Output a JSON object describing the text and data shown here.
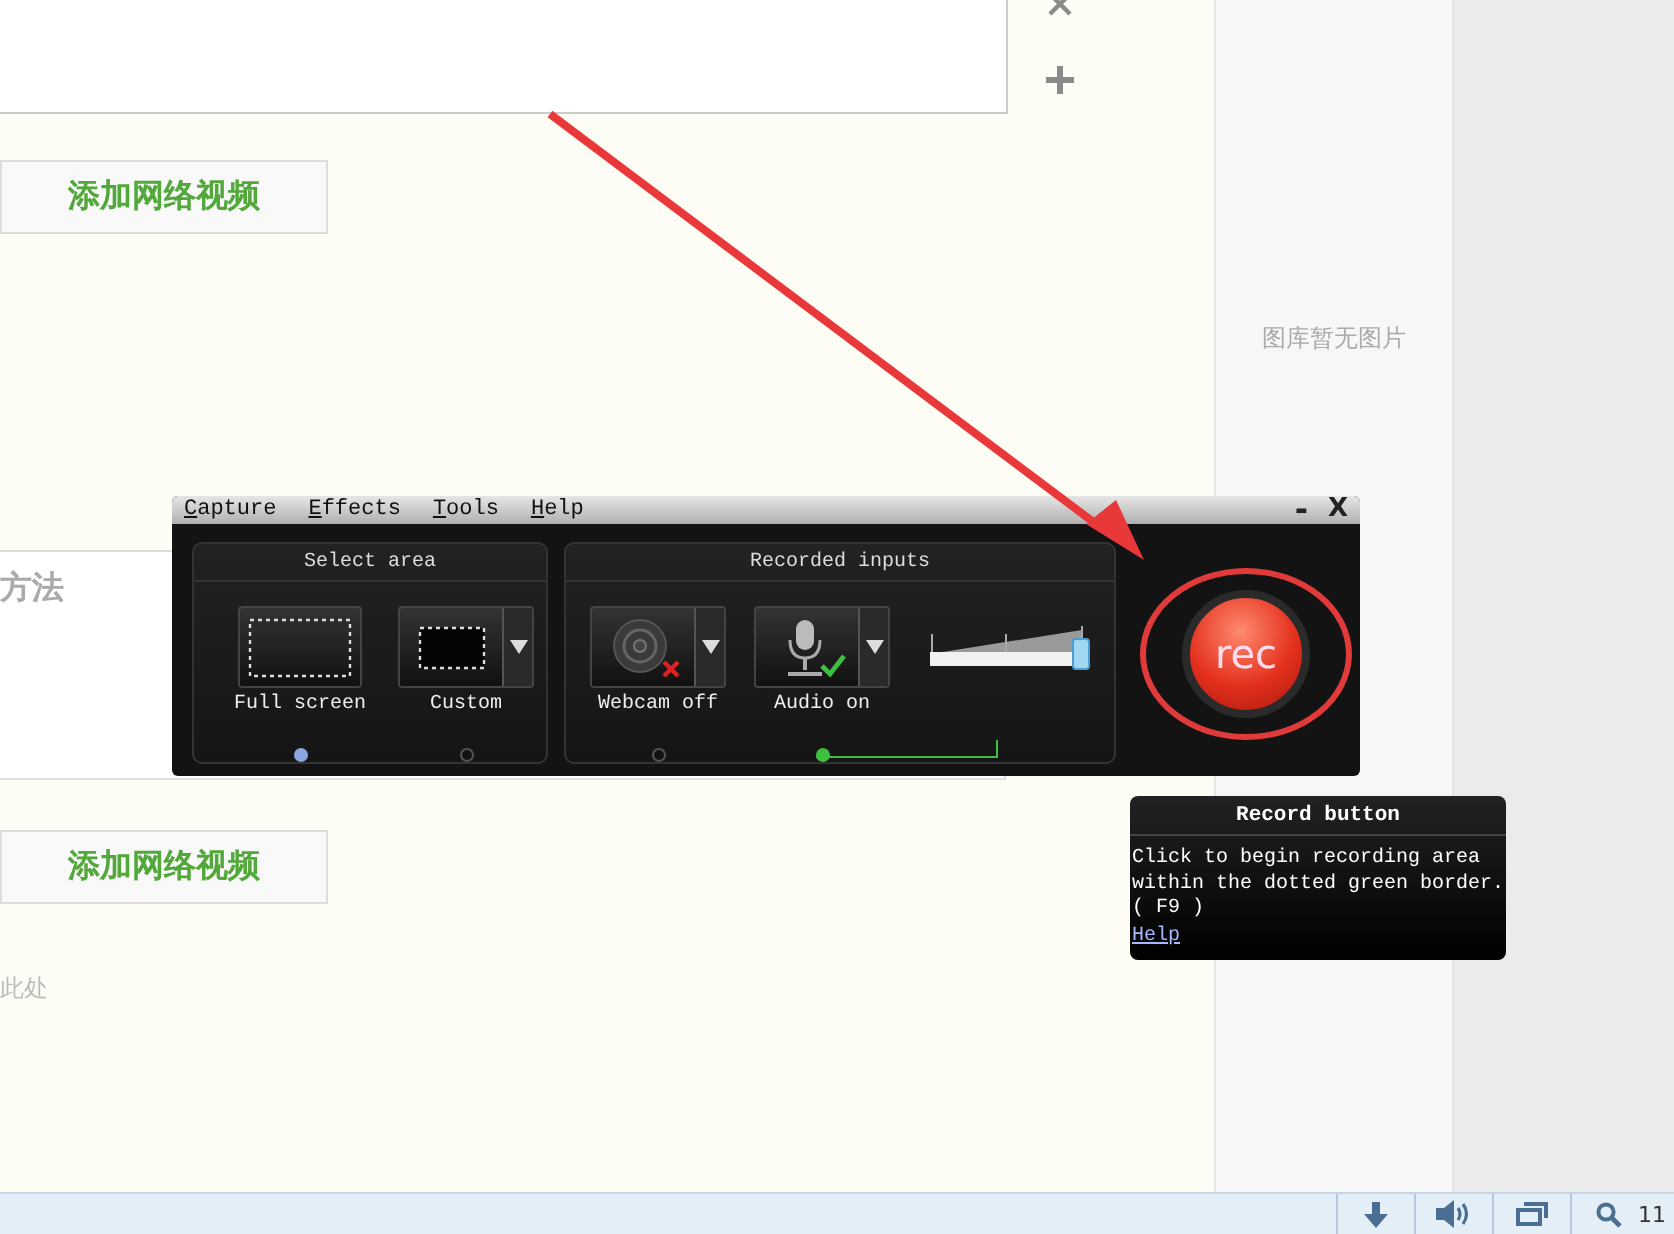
{
  "page": {
    "buttons": [
      {
        "label": "添加网络视频"
      },
      {
        "label": "添加网络视频"
      }
    ],
    "heading": "方法",
    "hint": "此处",
    "sidebar": {
      "empty_text": "图库暂无图片"
    }
  },
  "recorder": {
    "menu": [
      "Capture",
      "Effects",
      "Tools",
      "Help"
    ],
    "window_controls": [
      {
        "kind": "minimize",
        "label": "-"
      },
      {
        "kind": "close",
        "label": "X"
      }
    ],
    "sections": [
      {
        "title": "Select area",
        "options": [
          {
            "kind": "full",
            "label": "Full screen",
            "dropdown": false,
            "selected": true
          },
          {
            "kind": "custom",
            "label": "Custom",
            "dropdown": true,
            "selected": false
          }
        ]
      },
      {
        "title": "Recorded inputs",
        "options": [
          {
            "kind": "webcam",
            "label": "Webcam off",
            "dropdown": true,
            "selected": false
          },
          {
            "kind": "audio",
            "label": "Audio on",
            "dropdown": true,
            "selected": true
          }
        ],
        "volume": {
          "level": 0.95
        }
      }
    ],
    "rec_button": {
      "label": "rec"
    }
  },
  "tooltip": {
    "title": "Record button",
    "lines": [
      "Click to begin recording area",
      "within the dotted green border.",
      "( F9 )"
    ],
    "link": "Help"
  },
  "status_bar": {
    "text": "11"
  }
}
